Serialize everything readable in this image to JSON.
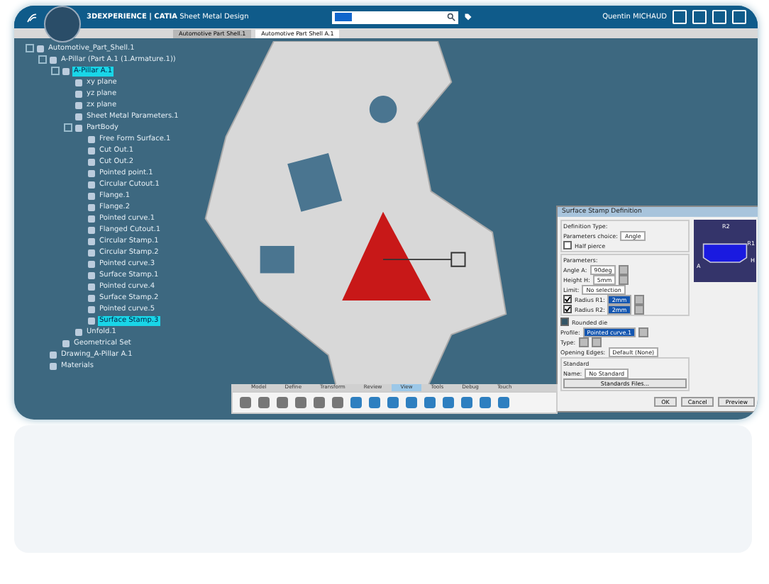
{
  "top_bar": {
    "brand": "3DEXPERIENCE | CATIA",
    "app": "Sheet Metal Design",
    "user": "Quentin MICHAUD"
  },
  "doc_tabs": [
    {
      "label": "Automotive Part Shell.1",
      "selected": false
    },
    {
      "label": "Automotive Part Shell A.1",
      "selected": true
    }
  ],
  "tree": [
    {
      "label": "Automotive_Part_Shell.1",
      "selected": false,
      "children": [
        {
          "label": "A-Pillar (Part A.1 (1.Armature.1))",
          "selected": false,
          "children": [
            {
              "label": "A-Pillar A.1",
              "selected": true,
              "children": [
                {
                  "label": "xy plane",
                  "selected": false
                },
                {
                  "label": "yz plane",
                  "selected": false
                },
                {
                  "label": "zx plane",
                  "selected": false
                },
                {
                  "label": "Sheet Metal Parameters.1",
                  "selected": false
                },
                {
                  "label": "PartBody",
                  "selected": false,
                  "children": [
                    {
                      "label": "Free Form Surface.1",
                      "selected": false
                    },
                    {
                      "label": "Cut Out.1",
                      "selected": false
                    },
                    {
                      "label": "Cut Out.2",
                      "selected": false
                    },
                    {
                      "label": "Pointed point.1",
                      "selected": false
                    },
                    {
                      "label": "Circular Cutout.1",
                      "selected": false
                    },
                    {
                      "label": "Flange.1",
                      "selected": false
                    },
                    {
                      "label": "Flange.2",
                      "selected": false
                    },
                    {
                      "label": "Pointed curve.1",
                      "selected": false
                    },
                    {
                      "label": "Flanged Cutout.1",
                      "selected": false
                    },
                    {
                      "label": "Circular Stamp.1",
                      "selected": false
                    },
                    {
                      "label": "Circular Stamp.2",
                      "selected": false
                    },
                    {
                      "label": "Pointed curve.3",
                      "selected": false
                    },
                    {
                      "label": "Surface Stamp.1",
                      "selected": false
                    },
                    {
                      "label": "Pointed curve.4",
                      "selected": false
                    },
                    {
                      "label": "Surface Stamp.2",
                      "selected": false
                    },
                    {
                      "label": "Pointed curve.5",
                      "selected": false
                    },
                    {
                      "label": "Surface Stamp.3",
                      "selected": true
                    }
                  ]
                },
                {
                  "label": "Unfold.1",
                  "selected": false
                }
              ]
            },
            {
              "label": "Geometrical Set",
              "selected": false
            }
          ]
        },
        {
          "label": "Drawing_A-Pillar A.1",
          "selected": false
        },
        {
          "label": "Materials",
          "selected": false
        }
      ]
    }
  ],
  "dialog": {
    "title": "Surface Stamp Definition",
    "definition_legend": "Definition Type:",
    "choice_label": "Parameters choice:",
    "choice_value": "Angle",
    "half_pierce": {
      "label": "Half pierce",
      "checked": false
    },
    "parameters_legend": "Parameters:",
    "rows": [
      {
        "kind": "spin",
        "label": "Angle A:",
        "value": "90deg"
      },
      {
        "kind": "spin",
        "label": "Height H:",
        "value": "5mm"
      },
      {
        "kind": "text",
        "label": "Limit:",
        "value": "No selection"
      },
      {
        "kind": "check",
        "label": "Radius R1:",
        "value": "2mm",
        "checked": true
      },
      {
        "kind": "check",
        "label": "Radius R2:",
        "value": "2mm",
        "checked": true
      }
    ],
    "rounded_die": {
      "label": "Rounded die",
      "checked": true
    },
    "profile_label": "Profile:",
    "profile_value": "Pointed curve.1",
    "type_label": "Type:",
    "opening_label": "Opening Edges:",
    "opening_value": "Default (None)",
    "standard_legend": "Standard",
    "name_label": "Name:",
    "name_value": "No Standard",
    "files_button": "Standards Files...",
    "preview_labels": [
      "R2",
      "R1",
      "A",
      "H"
    ],
    "buttons": [
      "OK",
      "Cancel",
      "Preview"
    ]
  },
  "toolbar_tabs": [
    {
      "label": "Model",
      "selected": false
    },
    {
      "label": "Define",
      "selected": false
    },
    {
      "label": "Transform",
      "selected": false
    },
    {
      "label": "Review",
      "selected": false
    },
    {
      "label": "View",
      "selected": true
    },
    {
      "label": "Tools",
      "selected": false
    },
    {
      "label": "Debug",
      "selected": false
    },
    {
      "label": "Touch",
      "selected": false
    }
  ]
}
